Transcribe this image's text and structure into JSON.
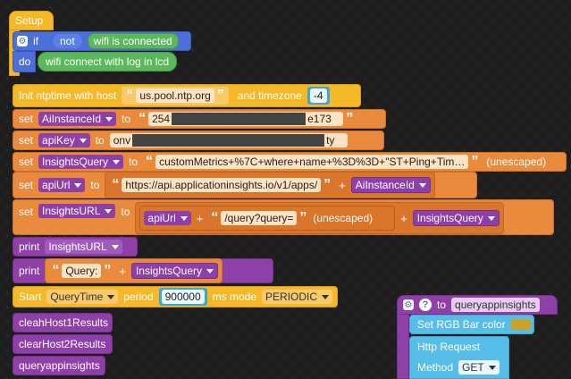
{
  "setup": {
    "label": "Setup",
    "if_label": "if",
    "not_label": "not",
    "wifi_connected": "wifi is connected",
    "do_label": "do",
    "wifi_connect": "wifi connect with log in lcd"
  },
  "ntp": {
    "prefix": "Init ntptime with host",
    "host": "us.pool.ntp.org",
    "tz_label": "and timezone",
    "tz_value": "-4"
  },
  "vars": {
    "set": "set",
    "to": "to",
    "ai_instance_id": "AiInstanceId",
    "ai_instance_id_pre": "254",
    "ai_instance_id_post": "e173",
    "api_key": "apiKey",
    "api_key_pre": "onv",
    "api_key_post": "ty",
    "insights_query": "InsightsQuery",
    "insights_query_value": "customMetrics+%7C+where+name+%3D%3D+\"ST+Ping+Tim…",
    "unescaped": "(unescaped)",
    "api_url": "apiUrl",
    "api_url_value": "https://api.applicationinsights.io/v1/apps/",
    "insights_url": "InsightsURL",
    "query_path": "/query?query=",
    "plus": "+"
  },
  "print": {
    "label": "print",
    "var": "InsightsURL",
    "query_text": "Query: "
  },
  "timer": {
    "start": "Start",
    "name": "QueryTime",
    "period": "period",
    "period_value": "900000",
    "mode": "ms mode",
    "mode_value": "PERIODIC"
  },
  "calls": [
    "cleahHost1Results",
    "clearHost2Results",
    "queryappinsights"
  ],
  "func": {
    "to": "to",
    "name": "queryappinsights",
    "rgb": "Set RGB Bar color",
    "rgb_color": "#c9a227",
    "http": "Http Request",
    "method": "Method",
    "method_value": "GET"
  }
}
